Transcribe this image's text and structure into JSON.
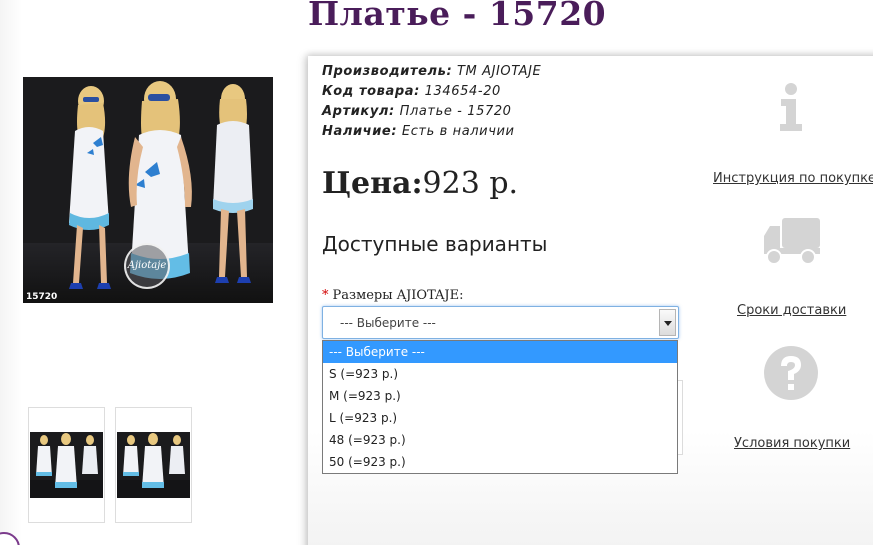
{
  "product": {
    "title": "Платье - 15720",
    "photo_code": "15720",
    "watermark": "Ajiotaje"
  },
  "specs": [
    {
      "label": "Производитель:",
      "value": "ТМ AJIOTAJE"
    },
    {
      "label": "Код товара:",
      "value": "134654-20"
    },
    {
      "label": "Артикул:",
      "value": "Платье - 15720"
    },
    {
      "label": "Наличие:",
      "value": "Есть в наличии"
    }
  ],
  "price": {
    "label": "Цена:",
    "value": "923 р."
  },
  "variants": {
    "title": "Доступные варианты",
    "required_mark": "*",
    "size_label": "Размеры AJIOTAJE:",
    "selected": "--- Выберите ---",
    "options": [
      "--- Выберите ---",
      "S (=923 р.)",
      "M (=923 р.)",
      "L (=923 р.)",
      "48 (=923 р.)",
      "50 (=923 р.)"
    ]
  },
  "side_links": [
    {
      "icon": "info-icon",
      "label": "Инструкция по покупке"
    },
    {
      "icon": "delivery-truck-icon",
      "label": "Сроки доставки"
    },
    {
      "icon": "question-icon",
      "label": "Условия покупки"
    }
  ],
  "colors": {
    "title": "#4a1d5a",
    "highlight": "#3399ff",
    "icon_gray": "#d4d4d4",
    "required": "#d10000"
  }
}
